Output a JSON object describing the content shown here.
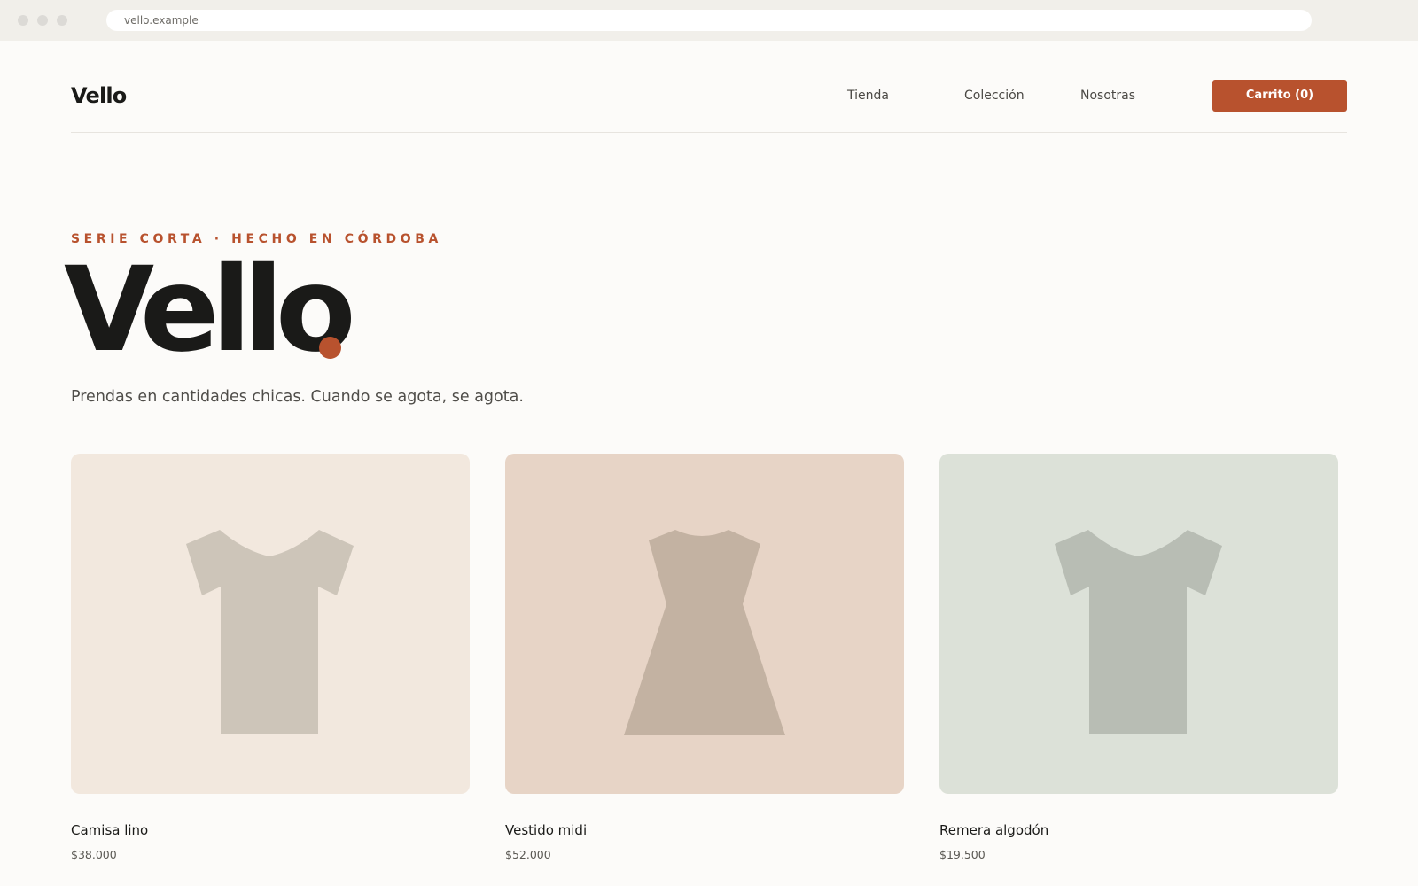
{
  "browser": {
    "url": "vello.example"
  },
  "header": {
    "logo": "Vello",
    "nav": [
      "Tienda",
      "Colección",
      "Nosotras"
    ],
    "cart_label": "Carrito (0)"
  },
  "hero": {
    "eyebrow": "SERIE CORTA · HECHO EN CÓRDOBA",
    "title": "Vello",
    "tagline": "Prendas en cantidades chicas. Cuando se agota, se agota."
  },
  "products": [
    {
      "name": "Camisa lino",
      "price": "$38.000",
      "icon": "shirt-icon",
      "bg": "#f2e8de",
      "shape_color": "#cdc5b9"
    },
    {
      "name": "Vestido midi",
      "price": "$52.000",
      "icon": "dress-icon",
      "bg": "#e7d4c6",
      "shape_color": "#c3b2a2"
    },
    {
      "name": "Remera algodón",
      "price": "$19.500",
      "icon": "tshirt-icon",
      "bg": "#dce1d8",
      "shape_color": "#b8bdb4"
    }
  ],
  "colors": {
    "accent": "#b8522e",
    "background": "#fcfbf9",
    "text": "#1a1a18"
  }
}
